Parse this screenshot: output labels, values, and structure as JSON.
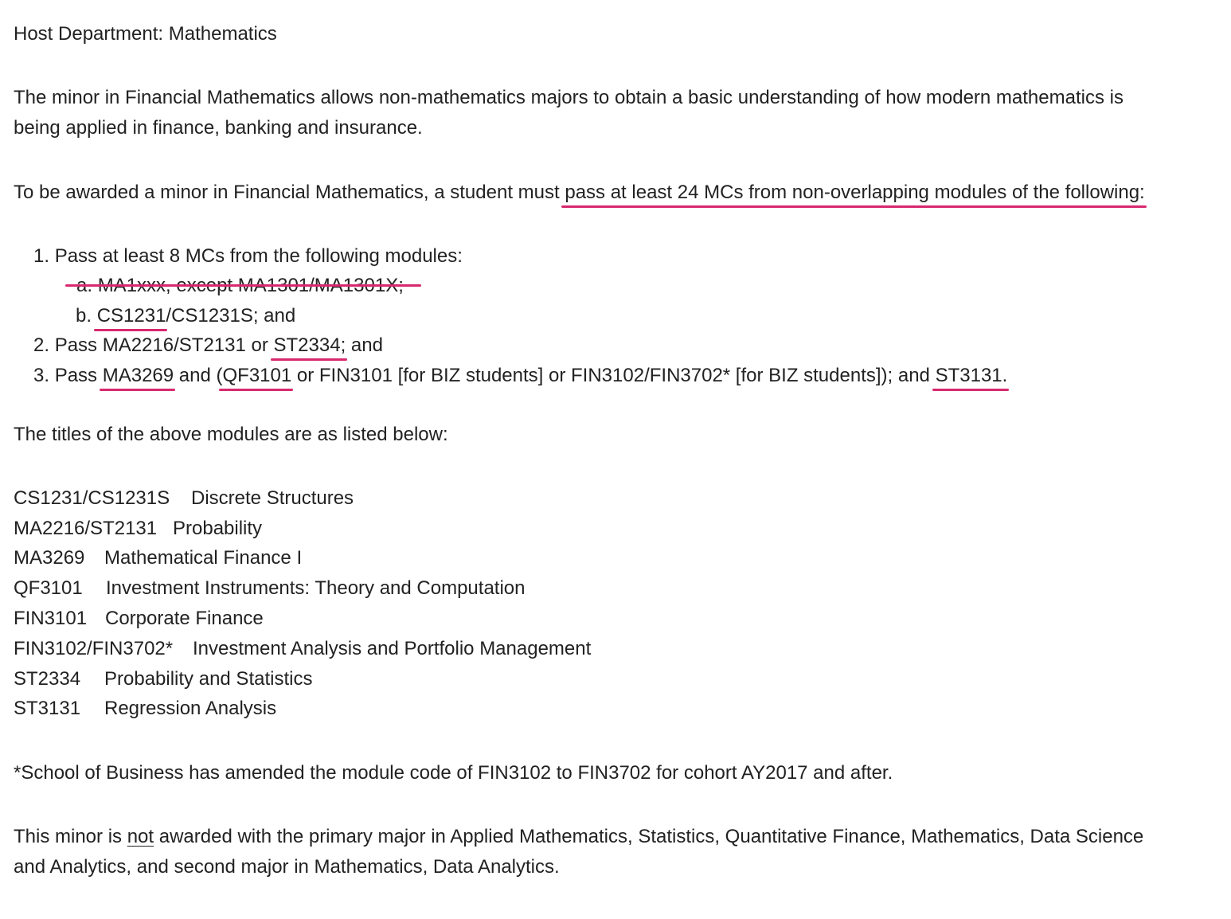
{
  "header": {
    "host_department": "Host Department: Mathematics"
  },
  "intro": {
    "line1": "The minor in Financial Mathematics allows non-mathematics majors to obtain a basic understanding of how modern mathematics is",
    "line2": "being applied in finance, banking and insurance."
  },
  "requirement": {
    "prefix": "To be awarded a minor in Financial Mathematics, a student must ",
    "highlight": "pass at least 24 MCs from non-overlapping modules of the following:"
  },
  "list": {
    "item1": {
      "number": "1.",
      "text": "Pass at least 8 MCs from the following modules:",
      "sub_a": {
        "letter": "a.",
        "text": "MA1xxx, except MA1301/MA1301X;"
      },
      "sub_b": {
        "letter": "b.",
        "highlight": "CS1231",
        "rest": "/CS1231S; and"
      }
    },
    "item2": {
      "number": "2.",
      "prefix": "Pass MA2216/ST2131 or ",
      "highlight": "ST2334;",
      "suffix": " and"
    },
    "item3": {
      "number": "3.",
      "prefix": "Pass ",
      "highlight1": "MA3269",
      "middle1": " and (",
      "highlight2": "QF3101",
      "middle2": " or FIN3101 [for BIZ students] or FIN3102/FIN3702* [for BIZ students]); and ",
      "highlight3": "ST3131."
    }
  },
  "titles_intro": "The titles of the above modules are as listed below:",
  "modules": [
    {
      "code": "CS1231/CS1231S",
      "title": "Discrete Structures"
    },
    {
      "code": "MA2216/ST2131",
      "title": "Probability"
    },
    {
      "code": "MA3269",
      "title": "Mathematical Finance I"
    },
    {
      "code": "QF3101",
      "title": "Investment Instruments: Theory and Computation"
    },
    {
      "code": "FIN3101",
      "title": "Corporate Finance"
    },
    {
      "code": "FIN3102/FIN3702*",
      "title": "Investment Analysis and Portfolio Management"
    },
    {
      "code": "ST2334",
      "title": "Probability and Statistics"
    },
    {
      "code": "ST3131",
      "title": "Regression Analysis"
    }
  ],
  "footnote": "*School of Business has amended the module code of FIN3102 to FIN3702 for cohort AY2017 and after.",
  "closing": {
    "prefix": "This minor is ",
    "emphasis": "not",
    "line1_rest": " awarded with the primary major in Applied Mathematics, Statistics, Quantitative Finance, Mathematics, Data Science",
    "line2": "and Analytics, and second major in Mathematics, Data Analytics."
  },
  "colors": {
    "annotation": "#d8286e",
    "text": "#222222"
  }
}
